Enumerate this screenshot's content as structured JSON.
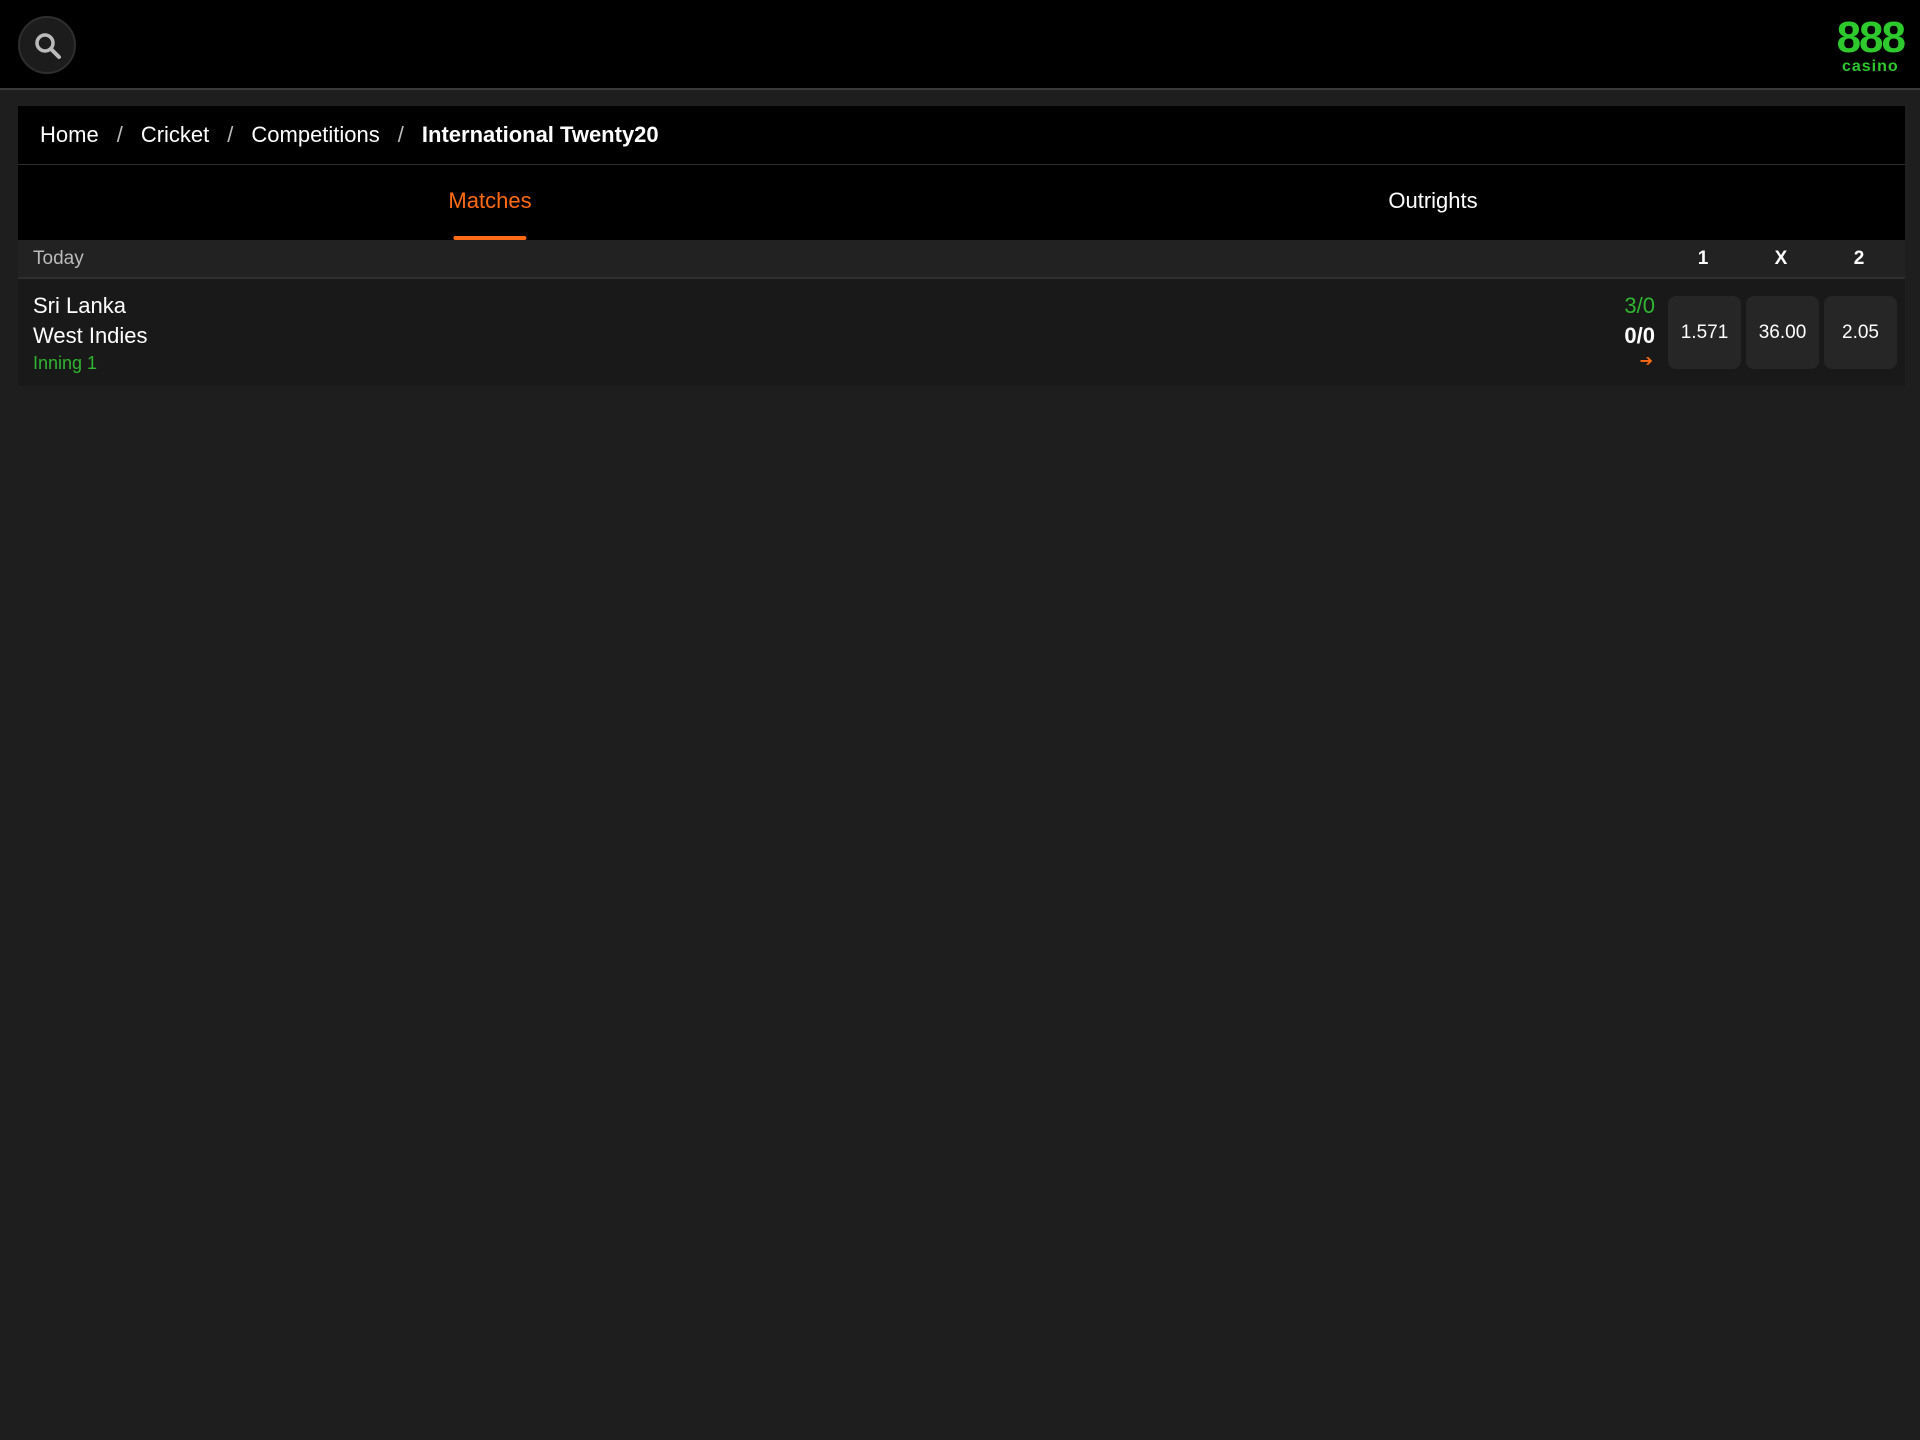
{
  "header": {
    "search_icon": "search-icon",
    "logo": {
      "number": "888",
      "word": "casino",
      "color": "#2dc92d"
    }
  },
  "breadcrumb": [
    "Home",
    "Cricket",
    "Competitions",
    "International Twenty20"
  ],
  "tabs": [
    {
      "label": "Matches",
      "active": true
    },
    {
      "label": "Outrights",
      "active": false
    }
  ],
  "accent_color": "#ff6a13",
  "section": {
    "label": "Today",
    "columns": [
      "1",
      "X",
      "2"
    ]
  },
  "match": {
    "home": "Sri Lanka",
    "away": "West Indies",
    "status": "Inning 1",
    "home_score": "3/0",
    "away_score": "0/0",
    "odds": [
      "1.571",
      "36.00",
      "2.05"
    ]
  }
}
